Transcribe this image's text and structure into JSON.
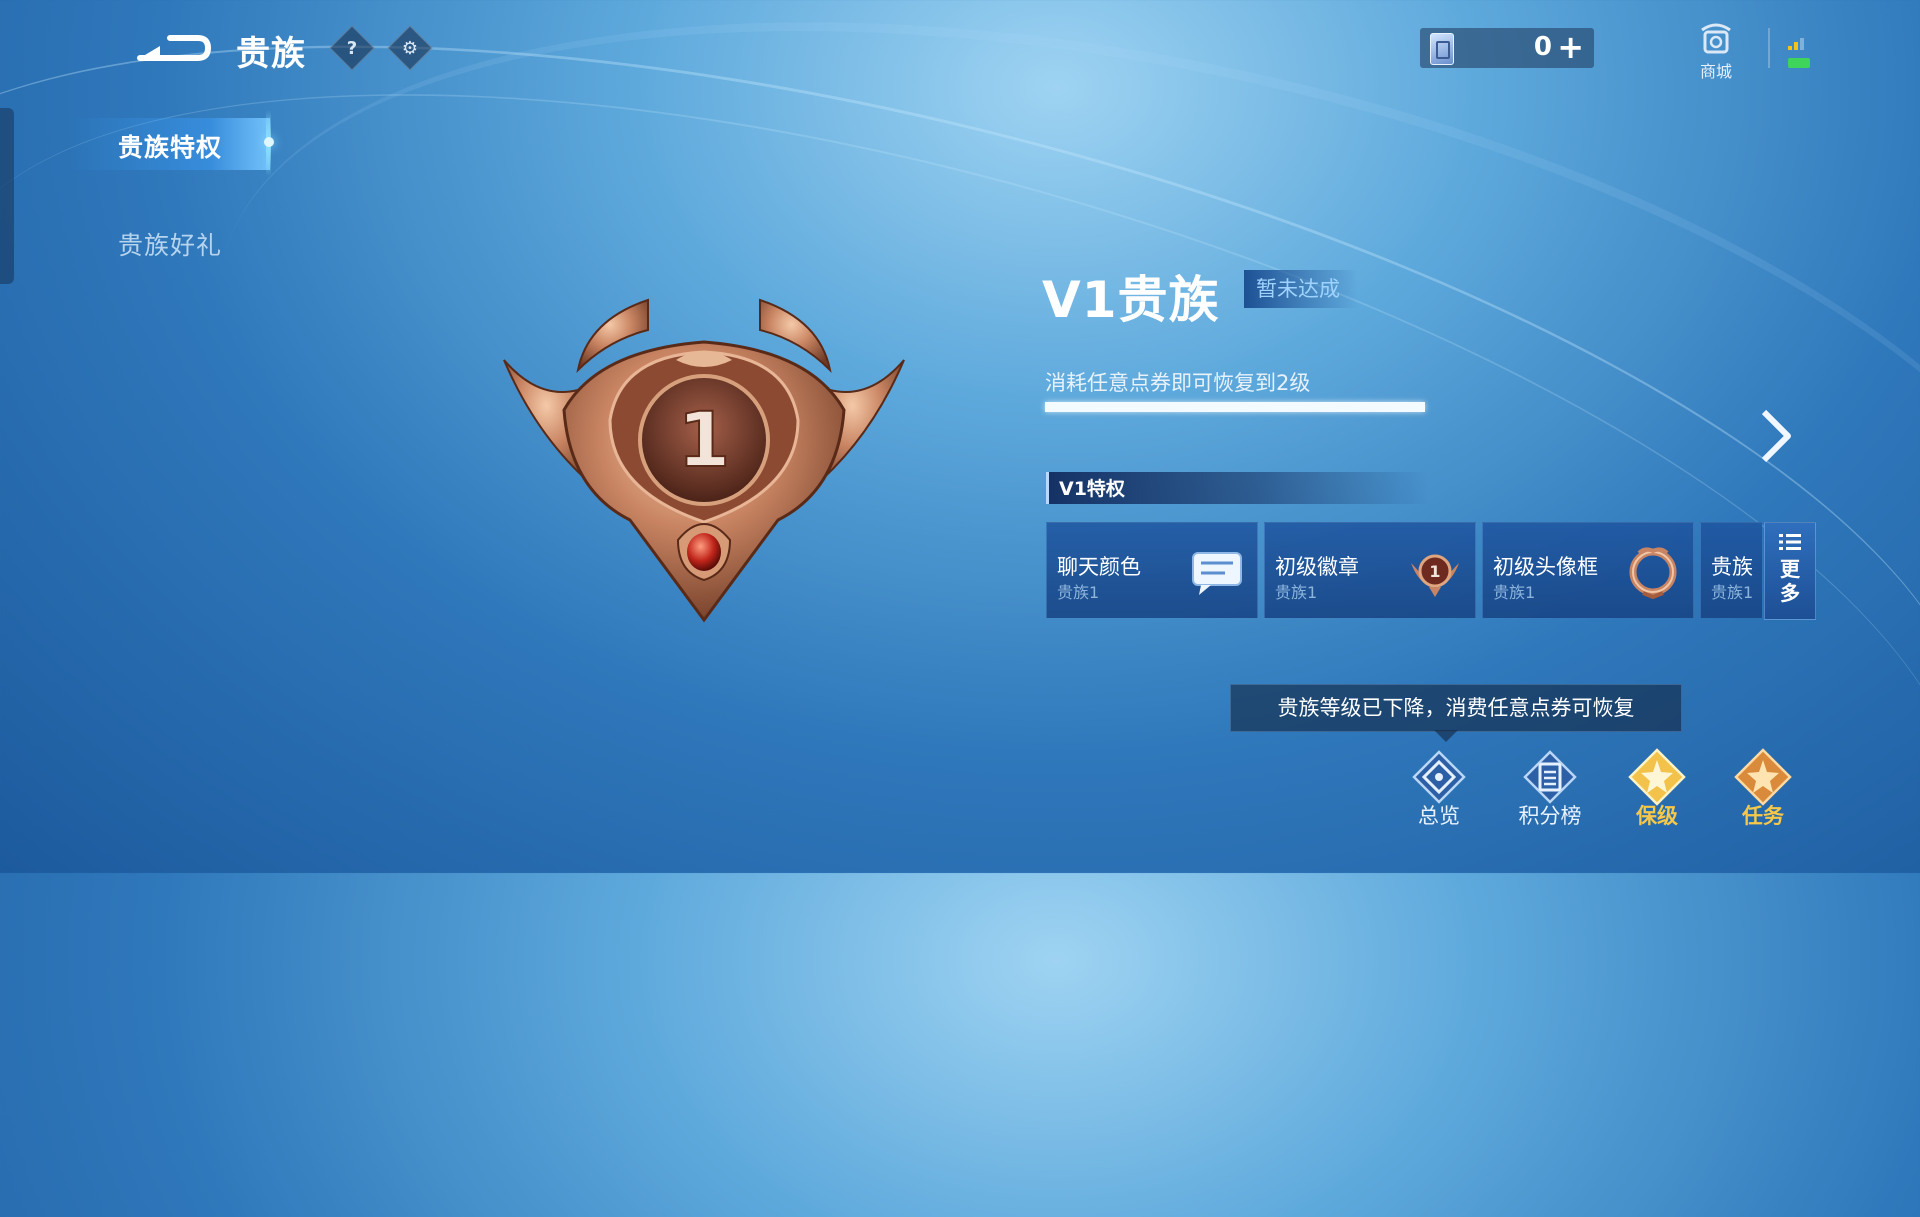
{
  "header": {
    "title": "贵族",
    "help_glyph": "?",
    "settings_glyph": "⚙",
    "currency_value": "0",
    "currency_plus": "+",
    "shop_label": "商城"
  },
  "sidebar": {
    "items": [
      {
        "label": "贵族特权",
        "active": true
      },
      {
        "label": "贵族好礼",
        "active": false
      }
    ]
  },
  "main": {
    "badge_level": "1",
    "level_title": "V1贵族",
    "status": "暂未达成",
    "hint": "消耗任意点券即可恢复到2级",
    "progress": 1.0,
    "section_title": "V1特权",
    "privileges": [
      {
        "name": "聊天颜色",
        "sub": "贵族1",
        "icon": "chat-bubble-icon"
      },
      {
        "name": "初级徽章",
        "sub": "贵族1",
        "icon": "badge-icon"
      },
      {
        "name": "初级头像框",
        "sub": "贵族1",
        "icon": "avatar-frame-icon"
      },
      {
        "name": "贵族",
        "sub": "贵族1",
        "icon": "partial-card"
      }
    ],
    "more_label_1": "更",
    "more_label_2": "多"
  },
  "toast": "贵族等级已下降，消费任意点券可恢复",
  "bottom_tabs": [
    {
      "label": "总览",
      "icon": "overview-icon"
    },
    {
      "label": "积分榜",
      "icon": "leaderboard-icon"
    },
    {
      "label": "保级",
      "icon": "keep-level-icon"
    },
    {
      "label": "任务",
      "icon": "tasks-icon"
    }
  ],
  "colors": {
    "accent_gold": "#f5c84a",
    "bronze": "#b5704a",
    "panel_blue": "#1d4f95"
  }
}
